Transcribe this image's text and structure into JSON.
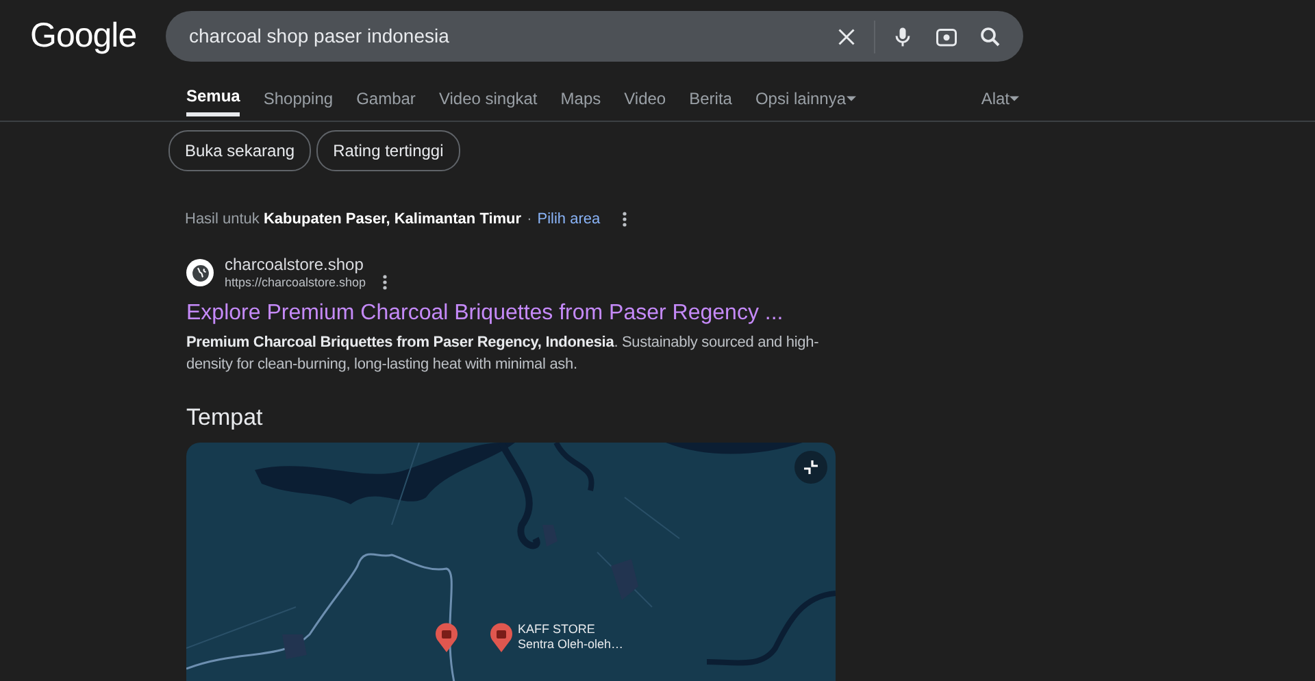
{
  "header": {
    "logo": "Google",
    "search": {
      "value": "charcoal shop paser indonesia"
    }
  },
  "tabs": [
    {
      "label": "Semua",
      "selected": true,
      "kind": "tab"
    },
    {
      "label": "Shopping",
      "selected": false,
      "kind": "tab"
    },
    {
      "label": "Gambar",
      "selected": false,
      "kind": "tab"
    },
    {
      "label": "Video singkat",
      "selected": false,
      "kind": "tab"
    },
    {
      "label": "Maps",
      "selected": false,
      "kind": "tab"
    },
    {
      "label": "Video",
      "selected": false,
      "kind": "tab"
    },
    {
      "label": "Berita",
      "selected": false,
      "kind": "tab"
    },
    {
      "label": "Opsi lainnya",
      "selected": false,
      "kind": "dropdown"
    }
  ],
  "tools": {
    "label": "Alat"
  },
  "chips": [
    "Buka sekarang",
    "Rating tertinggi"
  ],
  "location": {
    "text": "Hasil untuk **Kabupaten Paser, Kalimantan Timur**",
    "separator": "·",
    "link": "Pilih area"
  },
  "result": {
    "site": "charcoalstore.shop",
    "url": "https://charcoalstore.shop",
    "title": "Explore Premium Charcoal Briquettes from Paser Regency ...",
    "snippet": "**Premium Charcoal Briquettes from Paser Regency, Indonesia**. Sustainably sourced and high-density for clean-burning, long-lasting heat with minimal ash."
  },
  "places": {
    "heading": "Tempat",
    "pins": [
      {
        "kind": "plain"
      },
      {
        "kind": "labeled",
        "name": "KAFF STORE",
        "category": "Sentra Oleh-oleh…"
      }
    ]
  }
}
